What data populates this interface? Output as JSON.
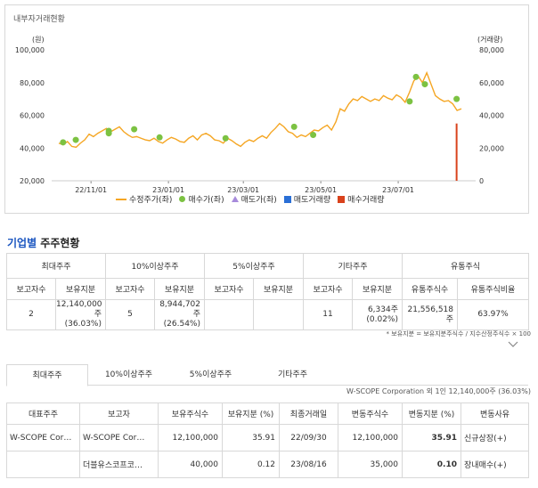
{
  "chart": {
    "title": "내부자거래현황",
    "left_unit": "(원)",
    "right_unit": "(거래량)",
    "left_ticks": [
      "100,000",
      "80,000",
      "60,000",
      "40,000",
      "20,000"
    ],
    "right_ticks": [
      "80,000",
      "60,000",
      "40,000",
      "20,000",
      "0"
    ],
    "x_ticks": [
      "22/11/01",
      "23/01/01",
      "23/03/01",
      "23/05/01",
      "23/07/01"
    ],
    "legend": {
      "adj_price": "수정주가(좌)",
      "buy_price": "매수가(좌)",
      "sell_price": "매도가(좌)",
      "sell_volume": "매도거래량",
      "buy_volume": "매수거래량"
    },
    "colors": {
      "price_line": "#f5a623",
      "buy_dot": "#7cc242",
      "sell_tri": "#a78bdb",
      "sell_vol": "#2a6fd6",
      "buy_vol": "#d9421c"
    }
  },
  "chart_data": {
    "type": "line",
    "title": "내부자거래현황",
    "xlabel": "",
    "ylabel": "(원)",
    "y2label": "(거래량)",
    "ylim": [
      20000,
      100000
    ],
    "y2lim": [
      0,
      80000
    ],
    "x_ticks": [
      "22/11/01",
      "23/01/01",
      "23/03/01",
      "23/05/01",
      "23/07/01"
    ],
    "series": [
      {
        "name": "수정주가(좌)",
        "values": [
          43000,
          42000,
          44000,
          41000,
          40500,
          43000,
          45000,
          48500,
          47000,
          49000,
          50500,
          52000,
          50000,
          51500,
          53000,
          50000,
          48000,
          46500,
          47000,
          46000,
          45000,
          44500,
          46000,
          44000,
          43000,
          45000,
          46500,
          45500,
          44000,
          43500,
          46000,
          47500,
          45000,
          48000,
          49000,
          47500,
          45000,
          44500,
          43000,
          46000,
          44500,
          42500,
          41000,
          43500,
          45000,
          44000,
          46000,
          47500,
          46000,
          49500,
          52000,
          55000,
          53000,
          50000,
          49000,
          46500,
          48000,
          47000,
          49000,
          51000,
          50500,
          52500,
          54000,
          51000,
          56000,
          64000,
          62500,
          67000,
          70000,
          69000,
          71500,
          70000,
          68500,
          70000,
          69000,
          72000,
          70500,
          69500,
          72500,
          71000,
          68000,
          74000,
          81000,
          84000,
          80000,
          86000,
          79000,
          72000,
          70000,
          68500,
          69000,
          67000,
          63000,
          64000
        ]
      },
      {
        "name": "매수가(좌)",
        "points": [
          [
            "22/10/10",
            43500
          ],
          [
            "22/10/20",
            45000
          ],
          [
            "22/11/15",
            50500
          ],
          [
            "22/11/15",
            49000
          ],
          [
            "22/12/05",
            51500
          ],
          [
            "22/12/25",
            46500
          ],
          [
            "23/02/15",
            46000
          ],
          [
            "23/04/10",
            53000
          ],
          [
            "23/04/25",
            48000
          ],
          [
            "23/07/10",
            68500
          ],
          [
            "23/07/15",
            83500
          ],
          [
            "23/07/22",
            79000
          ],
          [
            "23/08/16",
            70000
          ]
        ]
      },
      {
        "name": "매수거래량",
        "points": [
          [
            "23/08/16",
            35000
          ]
        ]
      }
    ]
  },
  "section": {
    "title_accent": "기업별",
    "title_rest": " 주주현황"
  },
  "holders_table": {
    "group_headers": [
      "최대주주",
      "10%이상주주",
      "5%이상주주",
      "기타주주",
      "유통주식"
    ],
    "sub_headers": [
      "보고자수",
      "보유지분",
      "보고자수",
      "보유지분",
      "보고자수",
      "보유지분",
      "보고자수",
      "보유지분",
      "유통주식수",
      "유통주식비율"
    ],
    "row": {
      "c1": "2",
      "c2a": "12,140,000주",
      "c2b": "(36.03%)",
      "c3": "5",
      "c4a": "8,944,702주",
      "c4b": "(26.54%)",
      "c5": "",
      "c6": "",
      "c7": "11",
      "c8a": "6,334주",
      "c8b": "(0.02%)",
      "c9": "21,556,518주",
      "c10": "63.97%"
    },
    "footnote": "* 보유지분 = 보유지분주식수 / 지수산정주식수 × 100"
  },
  "tabs": [
    "최대주주",
    "10%이상주주",
    "5%이상주주",
    "기타주주"
  ],
  "detail_caption": "W-SCOPE Corporation 외 1인 12,140,000주 (36.03%)",
  "detail_table": {
    "headers": [
      "대표주주",
      "보고자",
      "보유주식수",
      "보유지분 (%)",
      "최종거래일",
      "변동주식수",
      "변동지분 (%)",
      "변동사유"
    ],
    "rows": [
      {
        "rep": "W-SCOPE Cor…",
        "reporter": "W-SCOPE Cor…",
        "shares": "12,100,000",
        "pct": "35.91",
        "date": "22/09/30",
        "chg_shares": "12,100,000",
        "chg_pct": "35.91",
        "reason": "신규상장(+)"
      },
      {
        "rep": "",
        "reporter": "더블유스코프코…",
        "shares": "40,000",
        "pct": "0.12",
        "date": "23/08/16",
        "chg_shares": "35,000",
        "chg_pct": "0.10",
        "reason": "장내매수(+)"
      }
    ]
  }
}
